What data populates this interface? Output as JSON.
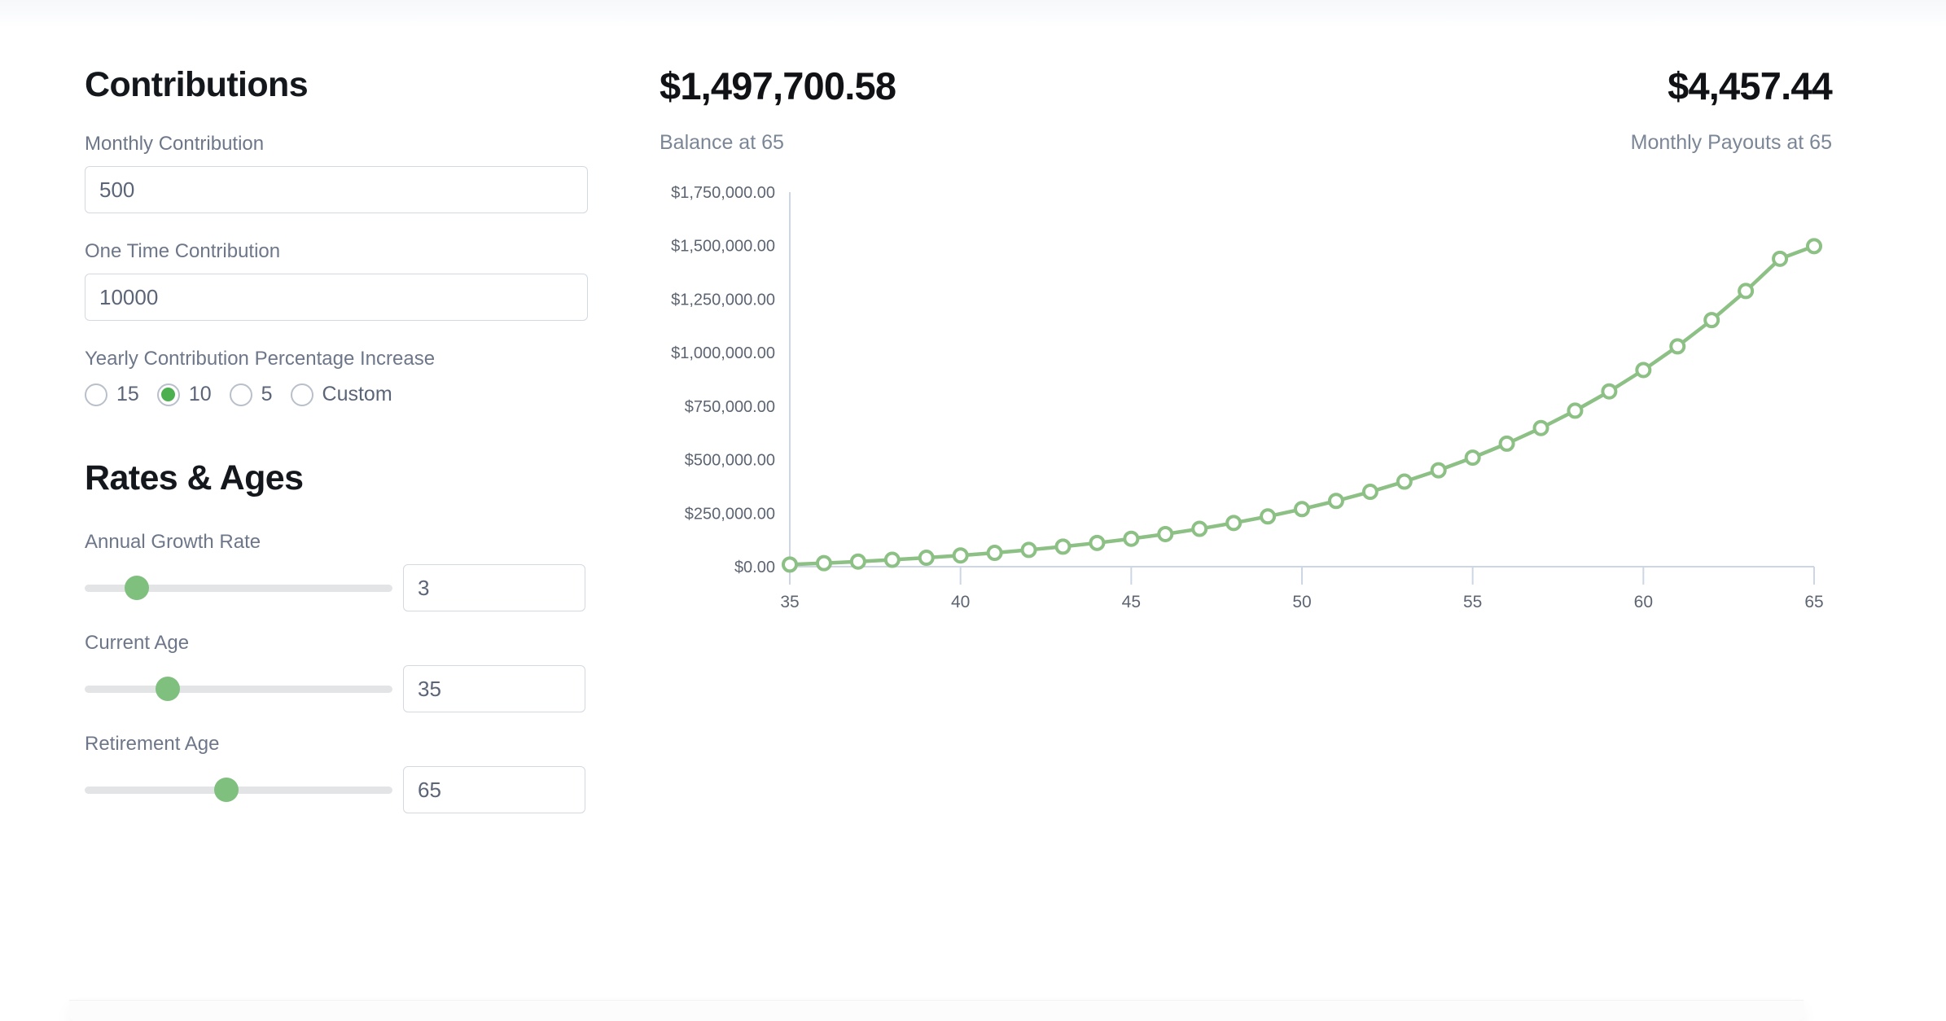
{
  "theme": {
    "accent_green": "#4caf50",
    "line_green": "#8cc084",
    "slider_thumb_green": "#7fc07f",
    "label_slate": "#6d7789",
    "value_slate": "#5b6577",
    "axis_gray": "#5d6572",
    "axis_line": "#ccd6e4"
  },
  "contributions": {
    "heading": "Contributions",
    "monthly": {
      "label": "Monthly Contribution",
      "value": "500",
      "placeholder": "Monthly Contribution"
    },
    "one_time": {
      "label": "One Time Contribution",
      "value": "10000",
      "placeholder": "One Time Contribution"
    },
    "yearly_increase": {
      "label": "Yearly Contribution Percentage Increase",
      "selected": "10",
      "options": [
        {
          "label": "15",
          "checked": false
        },
        {
          "label": "10",
          "checked": true
        },
        {
          "label": "5",
          "checked": false
        },
        {
          "label": "Custom",
          "checked": false
        }
      ]
    }
  },
  "rates_ages": {
    "heading": "Rates & Ages",
    "sliders": [
      {
        "label": "Annual Growth Rate",
        "value": "3",
        "min": 0,
        "max": 20,
        "thumb_percent": 17
      },
      {
        "label": "Current Age",
        "value": "35",
        "min": 18,
        "max": 80,
        "thumb_percent": 27
      },
      {
        "label": "Retirement Age",
        "value": "65",
        "min": 40,
        "max": 90,
        "thumb_percent": 46
      }
    ]
  },
  "summary": {
    "balance": {
      "value": "$1,497,700.58",
      "caption": "Balance at 65"
    },
    "payout": {
      "value": "$4,457.44",
      "caption": "Monthly Payouts at 65"
    }
  },
  "chart_data": {
    "type": "line",
    "title": "",
    "xlabel": "",
    "ylabel": "",
    "xlim": [
      35,
      65
    ],
    "ylim": [
      0,
      1750000
    ],
    "grid": false,
    "legend": false,
    "x_ticks": [
      35,
      40,
      45,
      50,
      55,
      60,
      65
    ],
    "x_tick_labels": [
      "35",
      "40",
      "45",
      "50",
      "55",
      "60",
      "65"
    ],
    "y_ticks": [
      0,
      250000,
      500000,
      750000,
      1000000,
      1250000,
      1500000,
      1750000
    ],
    "y_tick_labels": [
      "$0.00",
      "$250,000.00",
      "$500,000.00",
      "$750,000.00",
      "$1,000,000.00",
      "$1,250,000.00",
      "$1,500,000.00",
      "$1,750,000.00"
    ],
    "marker": "open-circle",
    "line_color": "#8cc084",
    "x": [
      35,
      36,
      37,
      38,
      39,
      40,
      41,
      42,
      43,
      44,
      45,
      46,
      47,
      48,
      49,
      50,
      51,
      52,
      53,
      54,
      55,
      56,
      57,
      58,
      59,
      60,
      61,
      62,
      63,
      64,
      65
    ],
    "series": [
      {
        "name": "Balance",
        "values": [
          10000,
          16480,
          23856,
          32234,
          41730,
          52474,
          64608,
          78291,
          93696,
          111018,
          130472,
          152295,
          176751,
          204131,
          234756,
          268983,
          307203,
          349849,
          397396,
          450369,
          509343,
          574954,
          647898,
          728943,
          818930,
          918783,
          1029515,
          1152239,
          1288178,
          1438676,
          1497700.58
        ]
      }
    ]
  }
}
